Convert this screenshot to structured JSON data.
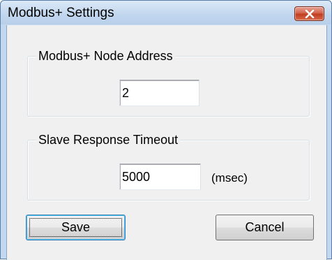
{
  "window": {
    "title": "Modbus+ Settings"
  },
  "node_address_group": {
    "label": "Modbus+ Node Address",
    "value": "2"
  },
  "timeout_group": {
    "label": "Slave Response Timeout",
    "value": "5000",
    "unit": "(msec)"
  },
  "buttons": {
    "save_label": "Save",
    "cancel_label": "Cancel"
  },
  "icons": {
    "close": "close-icon"
  },
  "colors": {
    "titlebar": "#c1d6ee",
    "close_button": "#c13c1f",
    "dialog_background": "#f0f0f0"
  }
}
